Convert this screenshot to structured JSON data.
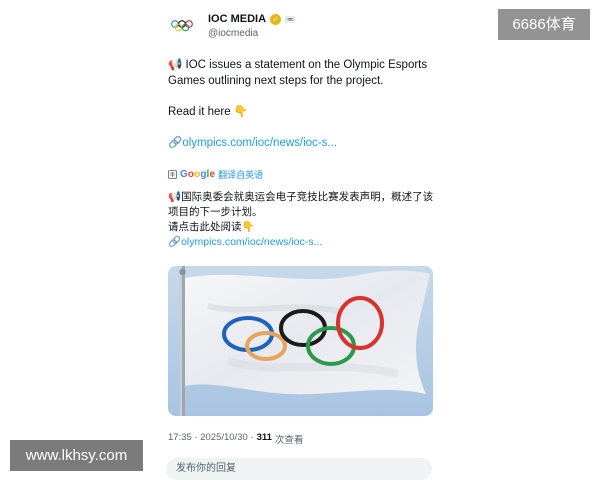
{
  "account": {
    "display_name": "IOC MEDIA",
    "handle": "@iocmedia",
    "avatar_icon": "olympic-rings-icon",
    "verified_icon": "gold-verified-icon"
  },
  "tweet": {
    "line1": "📢 IOC issues a statement on the Olympic Esports Games outlining next steps for the project.",
    "line2": "Read it here 👇",
    "link": "🔗olympics.com/ioc/news/ioc-s..."
  },
  "translation": {
    "google_g1": "G",
    "google_o1": "o",
    "google_o2": "o",
    "google_g2": "g",
    "google_l": "l",
    "google_e": "e",
    "label": "翻译自英语",
    "line1": "📢国际奥委会就奥运会电子竞技比赛发表声明，概述了该项目的下一步计划。",
    "line2": "请点击此处阅读👇",
    "link": "🔗olympics.com/ioc/news/ioc-s..."
  },
  "meta": {
    "time": "17:35 · 2025/10/30 ·",
    "views_count": "311",
    "views_label": "次查看"
  },
  "reply": {
    "placeholder": "发布你的回复"
  },
  "watermarks": {
    "top_right": "6686体育",
    "bottom_left": "www.lkhsy.com"
  },
  "colors": {
    "link": "#1d9bf0",
    "secondary_text": "#536471",
    "verified": "#e2b719"
  }
}
